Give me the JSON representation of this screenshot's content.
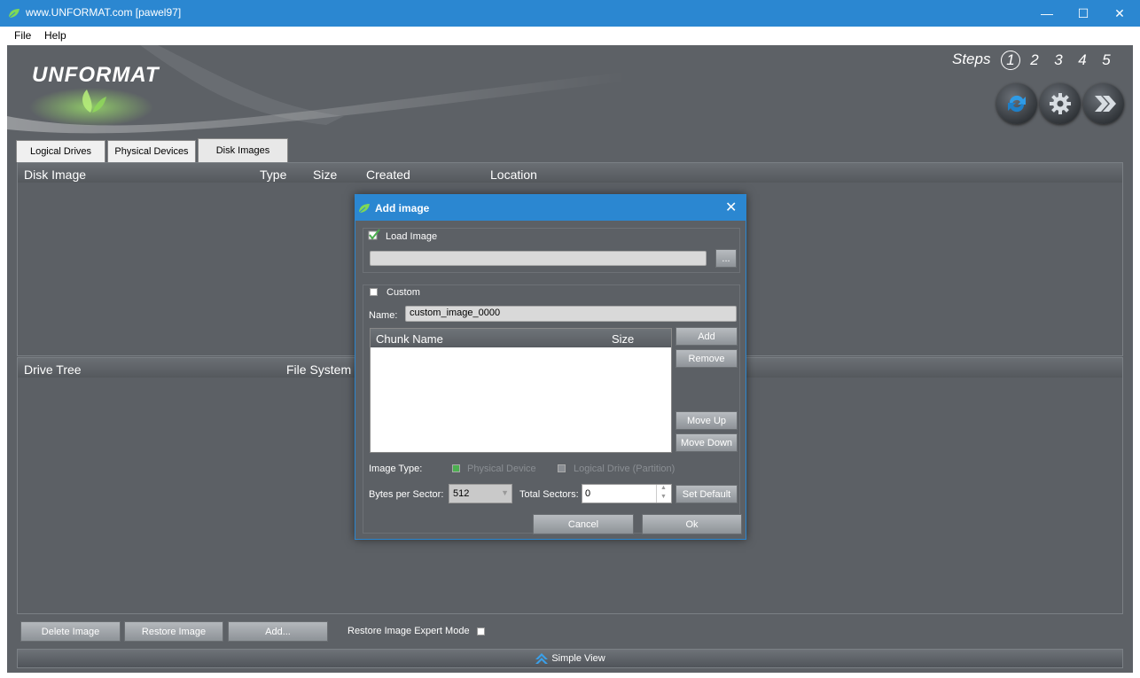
{
  "window": {
    "title": "www.UNFORMAT.com [pawel97]",
    "min_glyph": "—",
    "max_glyph": "☐",
    "close_glyph": "✕"
  },
  "menu": [
    "File",
    "Help"
  ],
  "logo": {
    "text": "UNFORMAT"
  },
  "steps": {
    "label": "Steps",
    "items": [
      "1",
      "2",
      "3",
      "4",
      "5"
    ],
    "active": "1"
  },
  "toolbar_icons": [
    "refresh-icon",
    "settings-icon",
    "next-icon"
  ],
  "tabs": [
    {
      "label": "Logical Drives"
    },
    {
      "label": "Physical Devices"
    },
    {
      "label": "Disk Images",
      "active": true
    }
  ],
  "images_panel": {
    "columns": [
      "Disk Image",
      "Type",
      "Size",
      "Created",
      "Location"
    ]
  },
  "tree_panel": {
    "columns": [
      "Drive Tree",
      "File System"
    ]
  },
  "bottom_buttons": {
    "delete": "Delete Image",
    "restore": "Restore Image",
    "add": "Add...",
    "expert_label": "Restore Image Expert Mode"
  },
  "simple_view": "Simple View",
  "dialog": {
    "title": "Add image",
    "close_glyph": "✕",
    "load_image_label": "Load Image",
    "load_image_checked": true,
    "browse_label": "...",
    "custom_label": "Custom",
    "custom_checked": false,
    "name_label": "Name:",
    "name_value": "custom_image_0000",
    "chunk_columns": [
      "Chunk Name",
      "Size"
    ],
    "side_buttons": {
      "add": "Add",
      "remove": "Remove",
      "move_up": "Move Up",
      "move_down": "Move Down"
    },
    "image_type_label": "Image Type:",
    "image_type_options": [
      "Physical Device",
      "Logical Drive (Partition)"
    ],
    "bytes_per_sector_label": "Bytes per Sector:",
    "bytes_per_sector_value": "512",
    "total_sectors_label": "Total Sectors:",
    "total_sectors_value": "0",
    "set_default": "Set Default",
    "cancel": "Cancel",
    "ok": "Ok",
    "colors": {
      "accent": "#2b87d1",
      "radio_selected": "#4caf50"
    }
  }
}
